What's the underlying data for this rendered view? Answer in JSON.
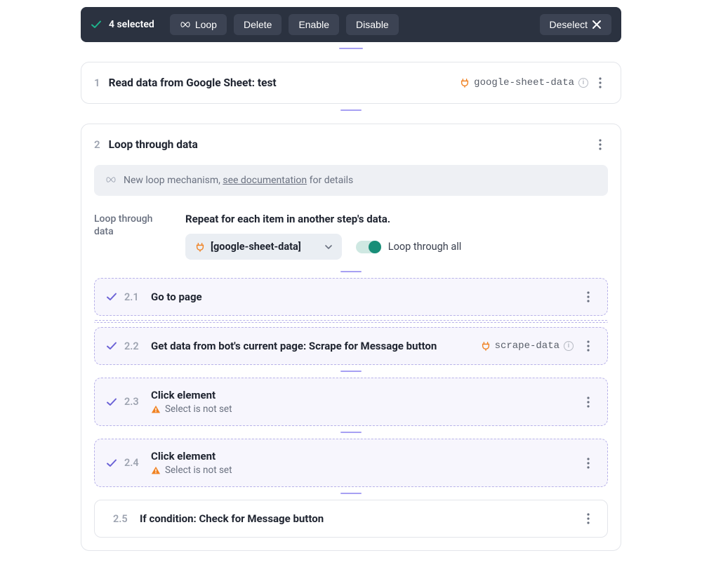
{
  "toolbar": {
    "selected_count": "4 selected",
    "loop_btn": "Loop",
    "delete_btn": "Delete",
    "enable_btn": "Enable",
    "disable_btn": "Disable",
    "deselect_btn": "Deselect"
  },
  "step1": {
    "num": "1",
    "title": "Read data from Google Sheet: test",
    "tag": "google-sheet-data"
  },
  "step2": {
    "num": "2",
    "title": "Loop through data",
    "notice_pre": "New loop mechanism, ",
    "notice_link": "see documentation",
    "notice_post": " for details",
    "config_label": "Loop through data",
    "config_subtitle": "Repeat for each item in another step's data.",
    "select_value": "[google-sheet-data]",
    "toggle_label": "Loop through all",
    "substeps": [
      {
        "num": "2.1",
        "title": "Go to page"
      },
      {
        "num": "2.2",
        "title": "Get data from bot's current page: Scrape for Message button",
        "tag": "scrape-data"
      },
      {
        "num": "2.3",
        "title": "Click element",
        "warn": "Select is not set"
      },
      {
        "num": "2.4",
        "title": "Click element",
        "warn": "Select is not set"
      },
      {
        "num": "2.5",
        "title": "If condition: Check for Message button"
      }
    ]
  }
}
